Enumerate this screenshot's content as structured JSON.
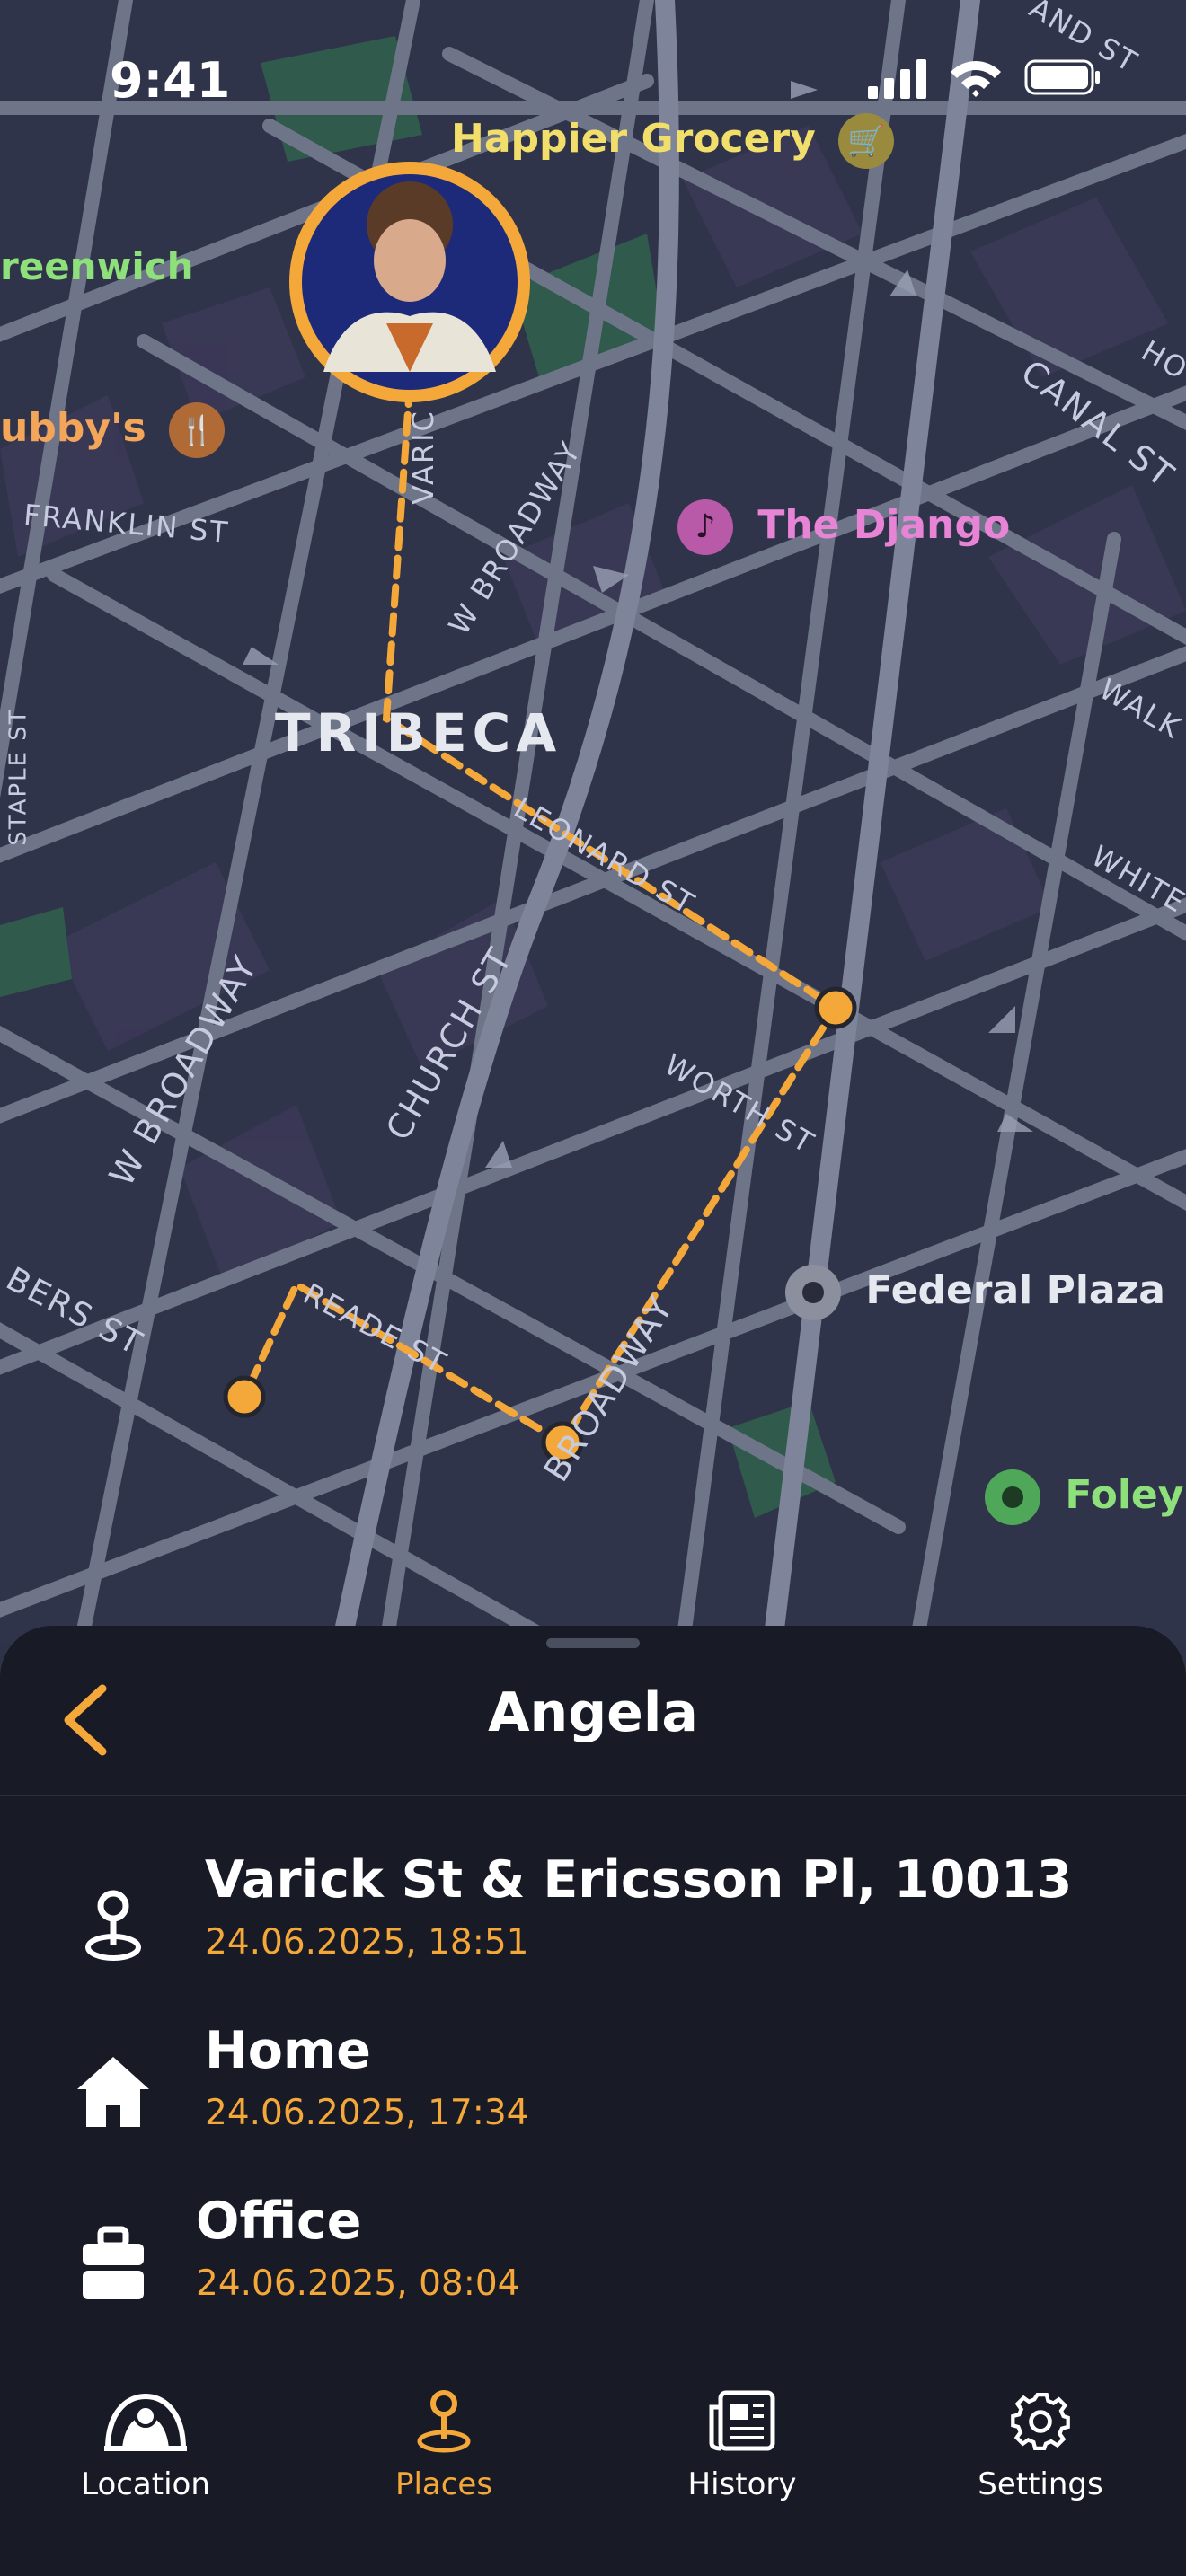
{
  "status_bar": {
    "time": "9:41"
  },
  "map": {
    "district": "TRIBECA",
    "pois": [
      {
        "name": "Happier Grocery",
        "color": "#f2df6b",
        "icon": "cart-icon"
      },
      {
        "name": "reenwich",
        "color": "#8ee07a",
        "icon": "none"
      },
      {
        "name": "ubby's",
        "color": "#f3a55a",
        "icon": "fork-knife-icon"
      },
      {
        "name": "The Django",
        "color": "#e884d6",
        "icon": "music-note-icon"
      },
      {
        "name": "Federal Plaza",
        "color": "#e6e8f0",
        "icon": "transit-icon"
      },
      {
        "name": "Foley S",
        "color": "#8ee07a",
        "icon": "park-icon"
      }
    ],
    "streets": [
      "FRANKLIN ST",
      "W BROADWAY",
      "VARIC",
      "LEONARD ST",
      "WORTH ST",
      "CHURCH ST",
      "W BROADWAY",
      "BERS ST",
      "READE ST",
      "BROADWAY",
      "CANAL ST",
      "STAPLE ST",
      "WALK",
      "WHITE",
      "AND ST",
      "HO"
    ],
    "route_color": "#f4a83a"
  },
  "sheet": {
    "title": "Angela",
    "places": [
      {
        "name": "Varick St & Ericsson Pl, 10013",
        "time": "24.06.2025, 18:51",
        "icon": "location-pin-icon"
      },
      {
        "name": "Home",
        "time": "24.06.2025, 17:34",
        "icon": "home-icon"
      },
      {
        "name": "Office",
        "time": "24.06.2025, 08:04",
        "icon": "briefcase-icon"
      }
    ]
  },
  "tabs": [
    {
      "label": "Location",
      "icon": "location-radar-icon",
      "active": false
    },
    {
      "label": "Places",
      "icon": "location-pin-icon",
      "active": true
    },
    {
      "label": "History",
      "icon": "newspaper-icon",
      "active": false
    },
    {
      "label": "Settings",
      "icon": "gear-icon",
      "active": false
    }
  ],
  "colors": {
    "accent": "#f4a83a",
    "sheet_bg": "#181b26",
    "map_bg": "#2f3347"
  }
}
